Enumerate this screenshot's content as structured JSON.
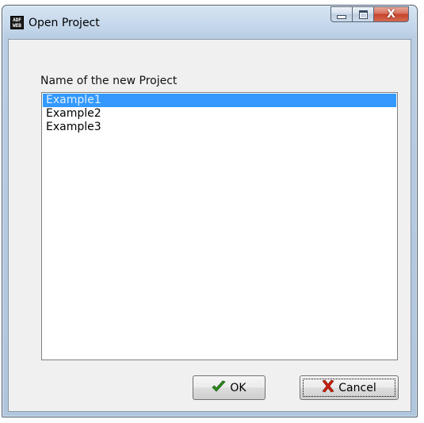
{
  "window": {
    "title": "Open Project",
    "icon_name": "app-logo-icon",
    "icon_text_line1": "ADF",
    "icon_text_line2": "WEB"
  },
  "caption_buttons": {
    "minimize_icon": "minimize-icon",
    "maximize_icon": "maximize-icon",
    "close_icon": "close-icon",
    "close_glyph": "X"
  },
  "dialog": {
    "label": "Name of the new Project",
    "projects": [
      {
        "label": "Example1",
        "selected": true
      },
      {
        "label": "Example2",
        "selected": false
      },
      {
        "label": "Example3",
        "selected": false
      }
    ]
  },
  "buttons": {
    "ok_label": "OK",
    "ok_icon": "checkmark-icon",
    "cancel_label": "Cancel",
    "cancel_icon": "x-mark-icon"
  },
  "colors": {
    "selection": "#3399ff",
    "ok_icon_color": "#2e8b1e",
    "cancel_icon_color": "#c81e0f"
  }
}
